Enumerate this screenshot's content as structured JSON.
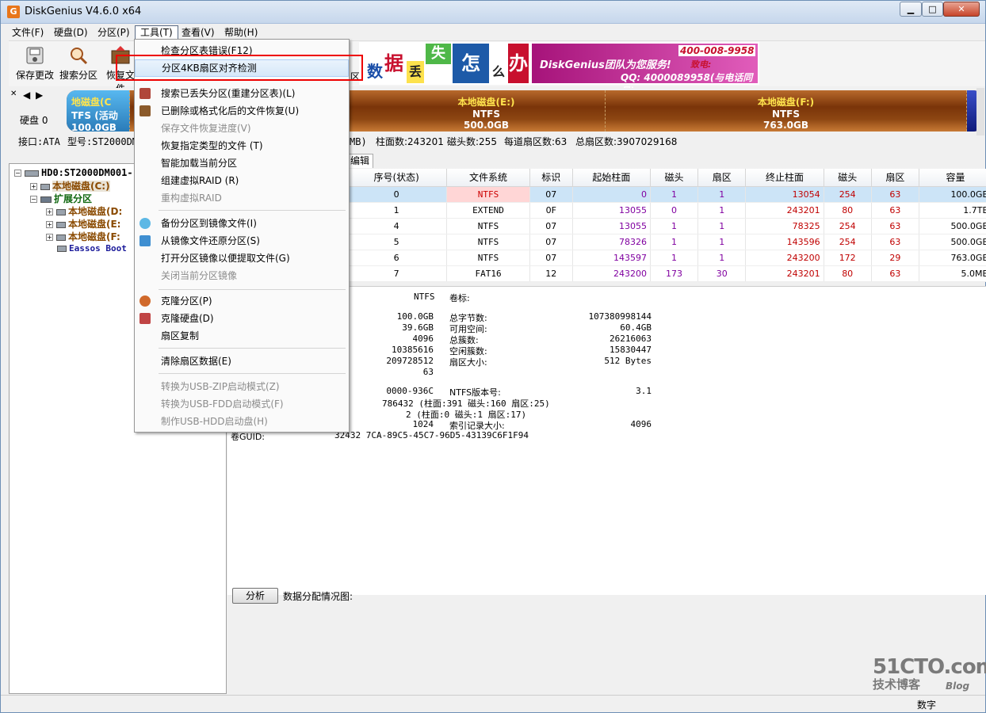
{
  "window": {
    "title": "DiskGenius V4.6.0 x64",
    "app_icon": "G"
  },
  "menubar": {
    "items": [
      "文件(F)",
      "硬盘(D)",
      "分区(P)",
      "工具(T)",
      "查看(V)",
      "帮助(H)"
    ]
  },
  "toolbar": {
    "save": "保存更改",
    "search": "搜索分区",
    "recover": "恢复文件",
    "last": "区"
  },
  "banner": {
    "chars": [
      "数",
      "据",
      "丢",
      "失",
      "怎",
      "么",
      "办",
      "!"
    ],
    "promo": "DiskGenius团队为您服务!",
    "qq": "QQ: 4000089958(与电话同号)",
    "hotline": "400-008-9958",
    "tel_label": "致电:"
  },
  "diskbar": {
    "label": "硬盘 0",
    "parts": [
      {
        "name": "地磁盘(C",
        "fs": "TFS (活动",
        "size": "100.0GB"
      },
      {
        "name": "本地磁盘(E:)",
        "fs": "NTFS",
        "size": "500.0GB"
      },
      {
        "name": "本地磁盘(F:)",
        "fs": "NTFS",
        "size": "763.0GB"
      }
    ]
  },
  "diskinfo": {
    "iface": "接口:ATA",
    "model": "型号:ST2000DMO",
    "mb": "MB)",
    "cyl": "柱面数:243201",
    "heads": "磁头数:255",
    "spt": "每道扇区数:63",
    "total": "总扇区数:3907029168"
  },
  "tree": {
    "disk": "HD0:ST2000DM001-",
    "c": "本地磁盘(C:)",
    "ext": "扩展分区",
    "d": "本地磁盘(D:",
    "e": "本地磁盘(E:",
    "f": "本地磁盘(F:",
    "eassos": "Eassos Boot"
  },
  "tabs": {
    "edit": "编辑"
  },
  "ptable": {
    "headers": [
      "序号(状态)",
      "文件系统",
      "标识",
      "起始柱面",
      "磁头",
      "扇区",
      "终止柱面",
      "磁头",
      "扇区",
      "容量"
    ],
    "rows": [
      [
        "0",
        "NTFS",
        "07",
        "0",
        "1",
        "1",
        "13054",
        "254",
        "63",
        "100.0GB"
      ],
      [
        "1",
        "EXTEND",
        "0F",
        "13055",
        "0",
        "1",
        "243201",
        "80",
        "63",
        "1.7TB"
      ],
      [
        "4",
        "NTFS",
        "07",
        "13055",
        "1",
        "1",
        "78325",
        "254",
        "63",
        "500.0GB"
      ],
      [
        "5",
        "NTFS",
        "07",
        "78326",
        "1",
        "1",
        "143596",
        "254",
        "63",
        "500.0GB"
      ],
      [
        "6",
        "NTFS",
        "07",
        "143597",
        "1",
        "1",
        "243200",
        "172",
        "29",
        "763.0GB"
      ],
      [
        "7",
        "FAT16",
        "12",
        "243200",
        "173",
        "30",
        "243201",
        "80",
        "63",
        "5.0MB"
      ]
    ]
  },
  "detail": {
    "fs": "NTFS",
    "vol_label": "卷标:",
    "v1": "100.0GB",
    "v2": "39.6GB",
    "v3": "4096",
    "v4": "10385616",
    "v5": "209728512",
    "v6": "63",
    "k1": "总字节数:",
    "k2": "可用空间:",
    "k3": "总簇数:",
    "k4": "空闲簇数:",
    "k5": "扇区大小:",
    "r1": "107380998144",
    "r2": "60.4GB",
    "r3": "26216063",
    "r4": "15830447",
    "r5": "512 Bytes",
    "a1": "0000-936C",
    "a2": "786432 (柱面:391 磁头:160 扇区:25)",
    "a3": "2 (柱面:0 磁头:1 扇区:17)",
    "a4": "1024",
    "guid_label": "卷GUID:",
    "guid": "32432 7CA-89C5-45C7-96D5-43139C6F1F94",
    "ntfsver_label": "NTFS版本号:",
    "ntfsver": "3.1",
    "idx_label": "索引记录大小:",
    "idx": "4096",
    "analyze": "分析",
    "alloc": "数据分配情况图:"
  },
  "dropdown": {
    "items": [
      "检查分区表错误(F12)",
      "分区4KB扇区对齐检测",
      "搜索已丢失分区(重建分区表)(L)",
      "已删除或格式化后的文件恢复(U)",
      "保存文件恢复进度(V)",
      "恢复指定类型的文件 (T)",
      "智能加载当前分区",
      "组建虚拟RAID (R)",
      "重构虚拟RAID",
      "备份分区到镜像文件(I)",
      "从镜像文件还原分区(S)",
      "打开分区镜像以便提取文件(G)",
      "关闭当前分区镜像",
      "克隆分区(P)",
      "克隆硬盘(D)",
      "扇区复制",
      "清除扇区数据(E)",
      "转换为USB-ZIP启动模式(Z)",
      "转换为USB-FDD启动模式(F)",
      "制作USB-HDD启动盘(H)"
    ]
  },
  "status": {
    "num": "数字"
  },
  "watermark": {
    "site": "51CTO.com",
    "sub": "技术博客",
    "blog": "Blog"
  }
}
